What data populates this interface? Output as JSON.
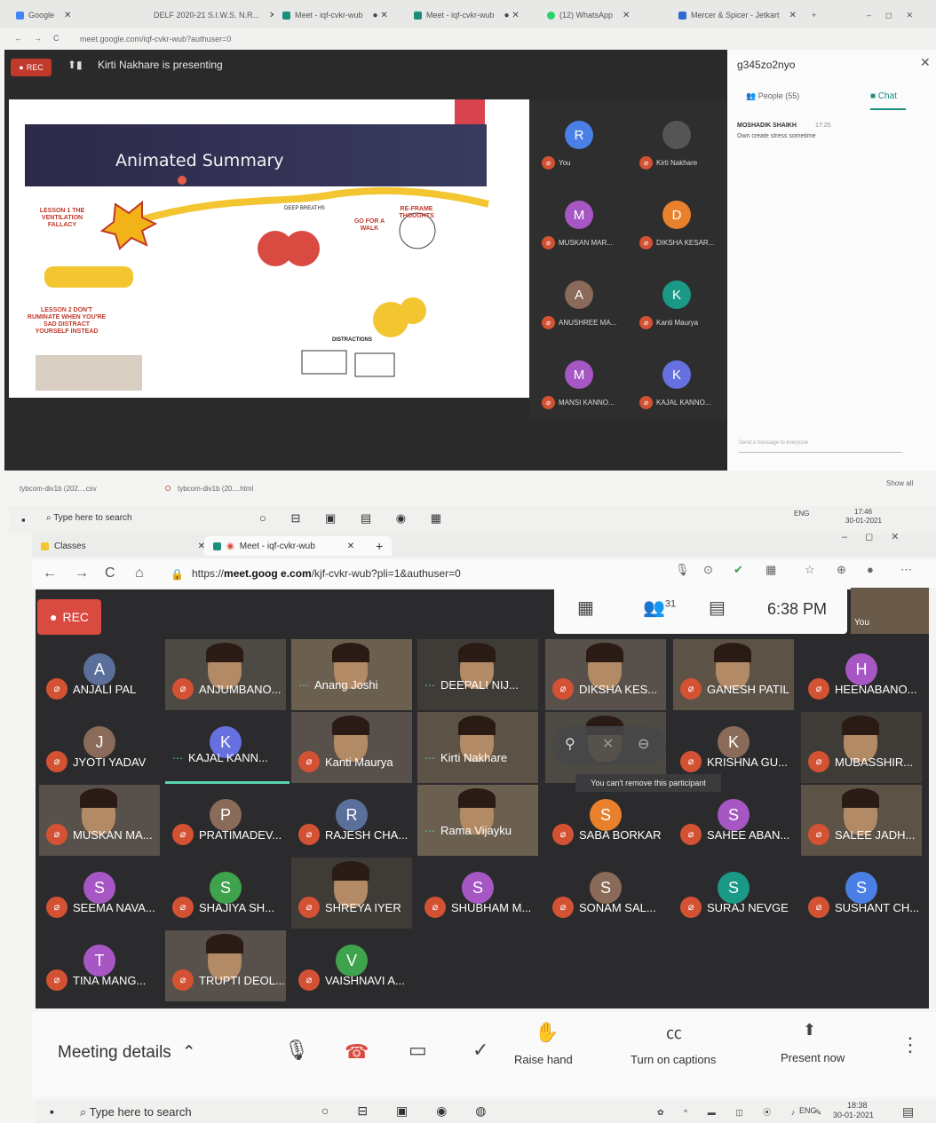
{
  "top_window": {
    "tabs": [
      {
        "label": "Google",
        "color": "#4285f4"
      },
      {
        "label": "DELF 2020-21 S.I.W.S. N.R...",
        "color": "#5b7fd1"
      },
      {
        "label": "Meet - iqf-cvkr-wub",
        "color": "#1a8e7d"
      },
      {
        "label": "Meet - iqf-cvkr-wub",
        "color": "#1a8e7d"
      },
      {
        "label": "(12) WhatsApp",
        "color": "#25d366"
      },
      {
        "label": "Mercer & Spicer - Jetkart",
        "color": "#2e6bd1"
      }
    ],
    "url": "meet.google.com/iqf-cvkr-wub?authuser=0",
    "rec_label": "REC",
    "presenting_text": "Kirti Nakhare is presenting",
    "slide": {
      "title": "Animated Summary",
      "labels": [
        "LESSON 1 THE VENTILATION FALLACY",
        "LESSON 2 DON'T RUMINATE WHEN YOU'RE SAD DISTRACT YOURSELF INSTEAD",
        "DEEP BREATHS",
        "GO FOR A WALK",
        "RE-FRAME THOUGHTS",
        "DISTRACTIONS"
      ]
    },
    "participants": [
      {
        "name": "You",
        "initial": "R",
        "color": "#4a80e6"
      },
      {
        "name": "Kirti Nakhare",
        "initial": "",
        "color": "#555555"
      },
      {
        "name": "MUSKAN MAR...",
        "initial": "M",
        "color": "#a757c4"
      },
      {
        "name": "DIKSHA KESAR...",
        "initial": "D",
        "color": "#e9812c"
      },
      {
        "name": "ANUSHREE MA...",
        "initial": "A",
        "color": "#8a6a58"
      },
      {
        "name": "Kanti Maurya",
        "initial": "K",
        "color": "#1a9a86"
      },
      {
        "name": "MANSI KANNO...",
        "initial": "M",
        "color": "#a757c4"
      },
      {
        "name": "KAJAL KANNO...",
        "initial": "K",
        "color": "#6670e0"
      }
    ],
    "side_panel": {
      "code": "g345zo2nyo",
      "people_tab": "People (55)",
      "chat_tab": "Chat",
      "message": {
        "sender": "MOSHADIK SHAIKH",
        "time": "17:25",
        "text": "Own create stress sometime"
      },
      "input_placeholder": "Send a message to everyone"
    },
    "downloads": [
      "tybcom-div1b (202....csv",
      "tybcom-div1b (20....html"
    ],
    "show_all": "Show all"
  },
  "taskbar_top": {
    "search_placeholder": "Type here to search",
    "time": "17:46",
    "date": "30-01-2021",
    "lang": "ENG"
  },
  "bottom_window": {
    "tabs": [
      {
        "label": "Classes"
      },
      {
        "label": "Meet - iqf-cvkr-wub"
      }
    ],
    "url_prefix": "https://",
    "url_host": "meet.goog e.com",
    "url_path": "/kjf-cvkr-wub?pli=1&authuser=0",
    "rec_label": "REC",
    "people_count": "31",
    "clock": "6:38 PM",
    "you_label": "You",
    "tooltip": "You can't remove this participant",
    "tiles": [
      {
        "name": "ANJALI PAL",
        "initial": "A",
        "color": "#5a6f9a",
        "video": false,
        "muted": true
      },
      {
        "name": "ANJUMBANO...",
        "initial": "",
        "color": "",
        "video": true,
        "muted": true
      },
      {
        "name": "Anang Joshi",
        "initial": "",
        "color": "",
        "video": true,
        "muted": false
      },
      {
        "name": "DEEPALI NIJ...",
        "initial": "",
        "color": "",
        "video": true,
        "muted": false
      },
      {
        "name": "DIKSHA KES...",
        "initial": "",
        "color": "",
        "video": true,
        "muted": true
      },
      {
        "name": "GANESH PATIL",
        "initial": "",
        "color": "",
        "video": true,
        "muted": true
      },
      {
        "name": "HEENABANO...",
        "initial": "H",
        "color": "#a757c4",
        "video": false,
        "muted": true
      },
      {
        "name": "JYOTI YADAV",
        "initial": "J",
        "color": "#8a6a58",
        "video": false,
        "muted": true
      },
      {
        "name": "KAJAL KANN...",
        "initial": "K",
        "color": "#6670e0",
        "video": false,
        "muted": false
      },
      {
        "name": "Kanti Maurya",
        "initial": "",
        "color": "",
        "video": true,
        "muted": true
      },
      {
        "name": "Kirti Nakhare",
        "initial": "",
        "color": "",
        "video": true,
        "muted": false
      },
      {
        "name": "",
        "initial": "",
        "color": "",
        "video": true,
        "muted": false
      },
      {
        "name": "KRISHNA GU...",
        "initial": "K",
        "color": "#8a6a58",
        "video": false,
        "muted": true
      },
      {
        "name": "MUBASSHIR...",
        "initial": "",
        "color": "",
        "video": true,
        "muted": true
      },
      {
        "name": "MUSKAN MA...",
        "initial": "",
        "color": "",
        "video": true,
        "muted": true
      },
      {
        "name": "PRATIMADEV...",
        "initial": "P",
        "color": "#8a6a58",
        "video": false,
        "muted": true
      },
      {
        "name": "RAJESH CHA...",
        "initial": "R",
        "color": "#5a6f9a",
        "video": false,
        "muted": true
      },
      {
        "name": "Rama Vijayku",
        "initial": "",
        "color": "",
        "video": true,
        "muted": false
      },
      {
        "name": "SABA BORKAR",
        "initial": "S",
        "color": "#e9812c",
        "video": false,
        "muted": true
      },
      {
        "name": "SAHEE ABAN...",
        "initial": "S",
        "color": "#a757c4",
        "video": false,
        "muted": true
      },
      {
        "name": "SALEE JADH...",
        "initial": "",
        "color": "",
        "video": true,
        "muted": true
      },
      {
        "name": "SEEMA NAVA...",
        "initial": "S",
        "color": "#a757c4",
        "video": false,
        "muted": true
      },
      {
        "name": "SHAJIYA SH...",
        "initial": "S",
        "color": "#3fa34d",
        "video": false,
        "muted": true
      },
      {
        "name": "SHREYA IYER",
        "initial": "",
        "color": "",
        "video": true,
        "muted": true
      },
      {
        "name": "SHUBHAM M...",
        "initial": "S",
        "color": "#a757c4",
        "video": false,
        "muted": true
      },
      {
        "name": "SONAM SAL...",
        "initial": "S",
        "color": "#8a6a58",
        "video": false,
        "muted": true
      },
      {
        "name": "SURAJ NEVGE",
        "initial": "S",
        "color": "#1a9a86",
        "video": false,
        "muted": true
      },
      {
        "name": "SUSHANT CH...",
        "initial": "S",
        "color": "#4a80e6",
        "video": false,
        "muted": true
      },
      {
        "name": "TINA MANG...",
        "initial": "T",
        "color": "#a757c4",
        "video": false,
        "muted": true
      },
      {
        "name": "TRUPTI DEOL...",
        "initial": "",
        "color": "",
        "video": true,
        "muted": true
      },
      {
        "name": "VAISHNAVI A...",
        "initial": "V",
        "color": "#3fa34d",
        "video": false,
        "muted": true
      }
    ],
    "bottom_bar": {
      "meeting_details": "Meeting details",
      "raise_hand": "Raise hand",
      "captions": "Turn on captions",
      "present": "Present now"
    }
  },
  "taskbar_bottom": {
    "search_placeholder": "Type here to search",
    "time": "18:38",
    "date": "30-01-2021",
    "lang": "ENG"
  },
  "colors": {
    "rec_red": "#d94a40",
    "meet_teal": "#1a8e7d",
    "mic_off": "#d35233"
  }
}
